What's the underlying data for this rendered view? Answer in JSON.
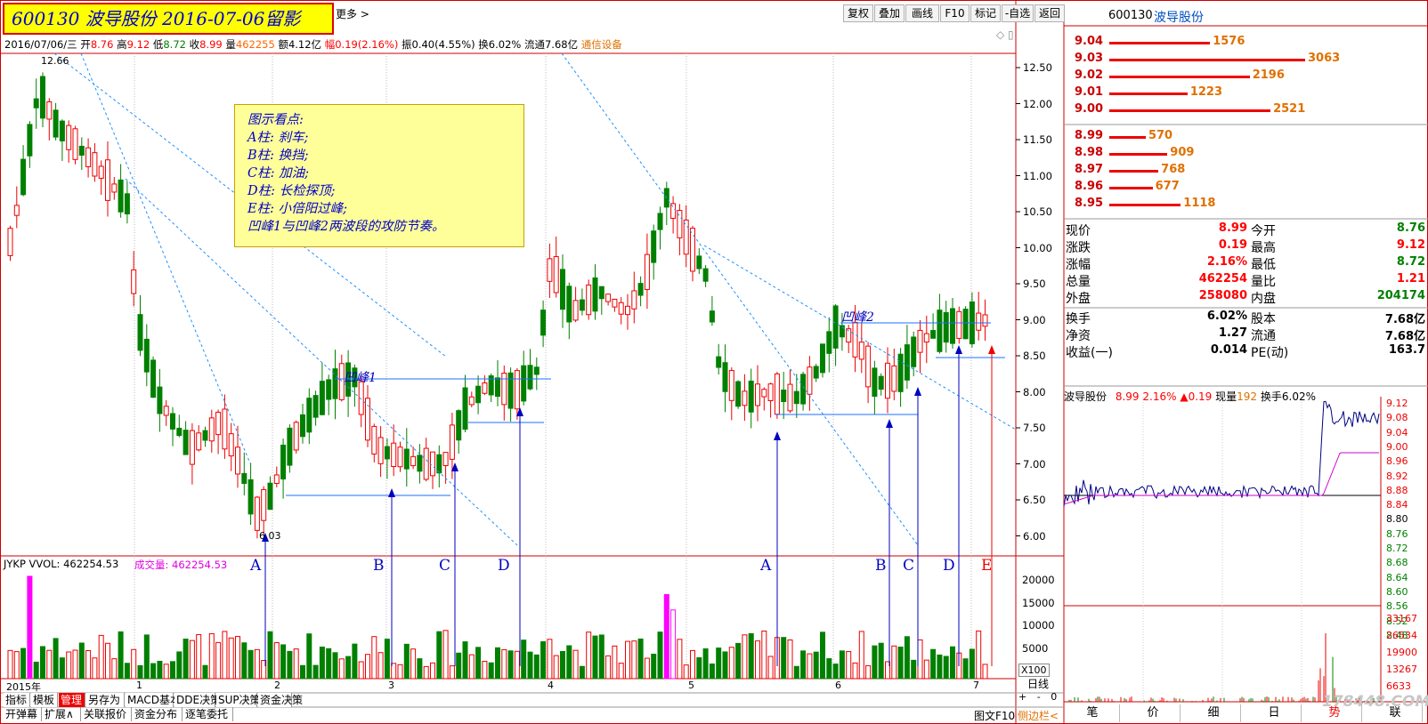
{
  "title_badge": "600130 波导股份 2016-07-06留影",
  "toolbar": {
    "more": "更多 >",
    "buttons": [
      "复权",
      "叠加",
      "画线",
      "F10",
      "标记",
      "-自选",
      "返回"
    ]
  },
  "infobar": {
    "date": "2016/07/06/三",
    "open_label": "开",
    "open": "8.76",
    "high_label": "高",
    "high": "9.12",
    "low_label": "低",
    "low": "8.72",
    "close_label": "收",
    "close": "8.99",
    "vol_label": "量",
    "vol": "462255",
    "amount_label": "额",
    "amount": "4.12亿",
    "change_label": "幅",
    "change": "0.19(2.16%)",
    "amp_label": "振",
    "amp": "0.40(4.55%)",
    "turnover_label": "换",
    "turnover": "6.02%",
    "float_label": "流通",
    "float": "7.68亿",
    "industry": "通信设备"
  },
  "annotation": {
    "lines": [
      "图示看点:",
      "A柱: 刹车;",
      "B柱: 换挡;",
      "C柱: 加油;",
      "D柱: 长检探顶;",
      "E柱: 小倍阳过峰;",
      "凹峰1与凹峰2两波段的攻防节奏。"
    ]
  },
  "peak_labels": [
    "凹峰1",
    "凹峰2"
  ],
  "wave_letters": [
    "A",
    "B",
    "C",
    "D",
    "A",
    "B",
    "C",
    "D",
    "E"
  ],
  "low_label": "6.03",
  "high_label": "12.66",
  "price_axis": [
    "12.50",
    "12.00",
    "11.50",
    "11.00",
    "10.50",
    "10.00",
    "9.50",
    "9.00",
    "8.50",
    "8.00",
    "7.50",
    "7.00",
    "6.50",
    "6.00"
  ],
  "vol_axis": [
    "20000",
    "15000",
    "10000",
    "5000"
  ],
  "vol_unit": "X100",
  "vol_header": {
    "left": "JYKP VVOL: 462254.53",
    "right": "成交量: 462254.53"
  },
  "x_labels": [
    "2015年",
    "1",
    "2",
    "3",
    "4",
    "5",
    "6",
    "7"
  ],
  "period_label": "日线",
  "zoom_plus": "+",
  "zoom_minus": "-",
  "zoom_zero": "0",
  "bottom_tabs_row1": [
    "指标",
    "模板",
    "管理",
    "另存为",
    "MACD基本",
    "DDE决策",
    "SUP决策",
    "资金决策"
  ],
  "bottom_tabs_row2": [
    "开弹幕",
    "扩展∧",
    "关联报价",
    "资金分布",
    "逐笔委托"
  ],
  "bottom_right": [
    "图文F10",
    "侧边栏<"
  ],
  "right_panel": {
    "code": "600130",
    "name": "波导股份",
    "asks": [
      {
        "price": "9.04",
        "vol": "1576"
      },
      {
        "price": "9.03",
        "vol": "3063"
      },
      {
        "price": "9.02",
        "vol": "2196"
      },
      {
        "price": "9.01",
        "vol": "1223"
      },
      {
        "price": "9.00",
        "vol": "2521"
      }
    ],
    "bids": [
      {
        "price": "8.99",
        "vol": "570"
      },
      {
        "price": "8.98",
        "vol": "909"
      },
      {
        "price": "8.97",
        "vol": "768"
      },
      {
        "price": "8.96",
        "vol": "677"
      },
      {
        "price": "8.95",
        "vol": "1118"
      }
    ],
    "quote": [
      {
        "l1": "现价",
        "v1": "8.99",
        "l2": "今开",
        "v2": "8.76"
      },
      {
        "l1": "涨跌",
        "v1": "0.19",
        "l2": "最高",
        "v2": "9.12"
      },
      {
        "l1": "涨幅",
        "v1": "2.16%",
        "l2": "最低",
        "v2": "8.72"
      },
      {
        "l1": "总量",
        "v1": "462254",
        "l2": "量比",
        "v2": "1.21"
      },
      {
        "l1": "外盘",
        "v1": "258080",
        "l2": "内盘",
        "v2": "204174"
      },
      {
        "l1": "换手",
        "v1": "6.02%",
        "l2": "股本",
        "v2": "7.68亿"
      },
      {
        "l1": "净资",
        "v1": "1.27",
        "l2": "流通",
        "v2": "7.68亿"
      },
      {
        "l1": "收益(一)",
        "v1": "0.014",
        "l2": "PE(动)",
        "v2": "163.7"
      }
    ],
    "intraday_header": {
      "name": "波导股份",
      "price": "8.99",
      "pct": "2.16%",
      "chg": "▲0.19",
      "now_label": "现量",
      "now": "192",
      "turn_label": "换手",
      "turn": "6.02%"
    },
    "intraday_axis": [
      "9.12",
      "9.08",
      "9.04",
      "9.00",
      "8.96",
      "8.92",
      "8.88",
      "8.84",
      "8.80",
      "8.76",
      "8.72",
      "8.68",
      "8.64",
      "8.60",
      "8.56",
      "8.52",
      "8.48"
    ],
    "intraday_vol_axis": [
      "33167",
      "26534",
      "19900",
      "13267",
      "6633"
    ],
    "tabs": [
      "笔",
      "价",
      "细",
      "日",
      "势",
      "联"
    ],
    "watermark": "178448.COM"
  },
  "colors": {
    "up": "#ff0000",
    "down": "#008000",
    "ma": "#0000ff",
    "vol_hi": "#ff00ff",
    "accent": "#ff6600"
  }
}
